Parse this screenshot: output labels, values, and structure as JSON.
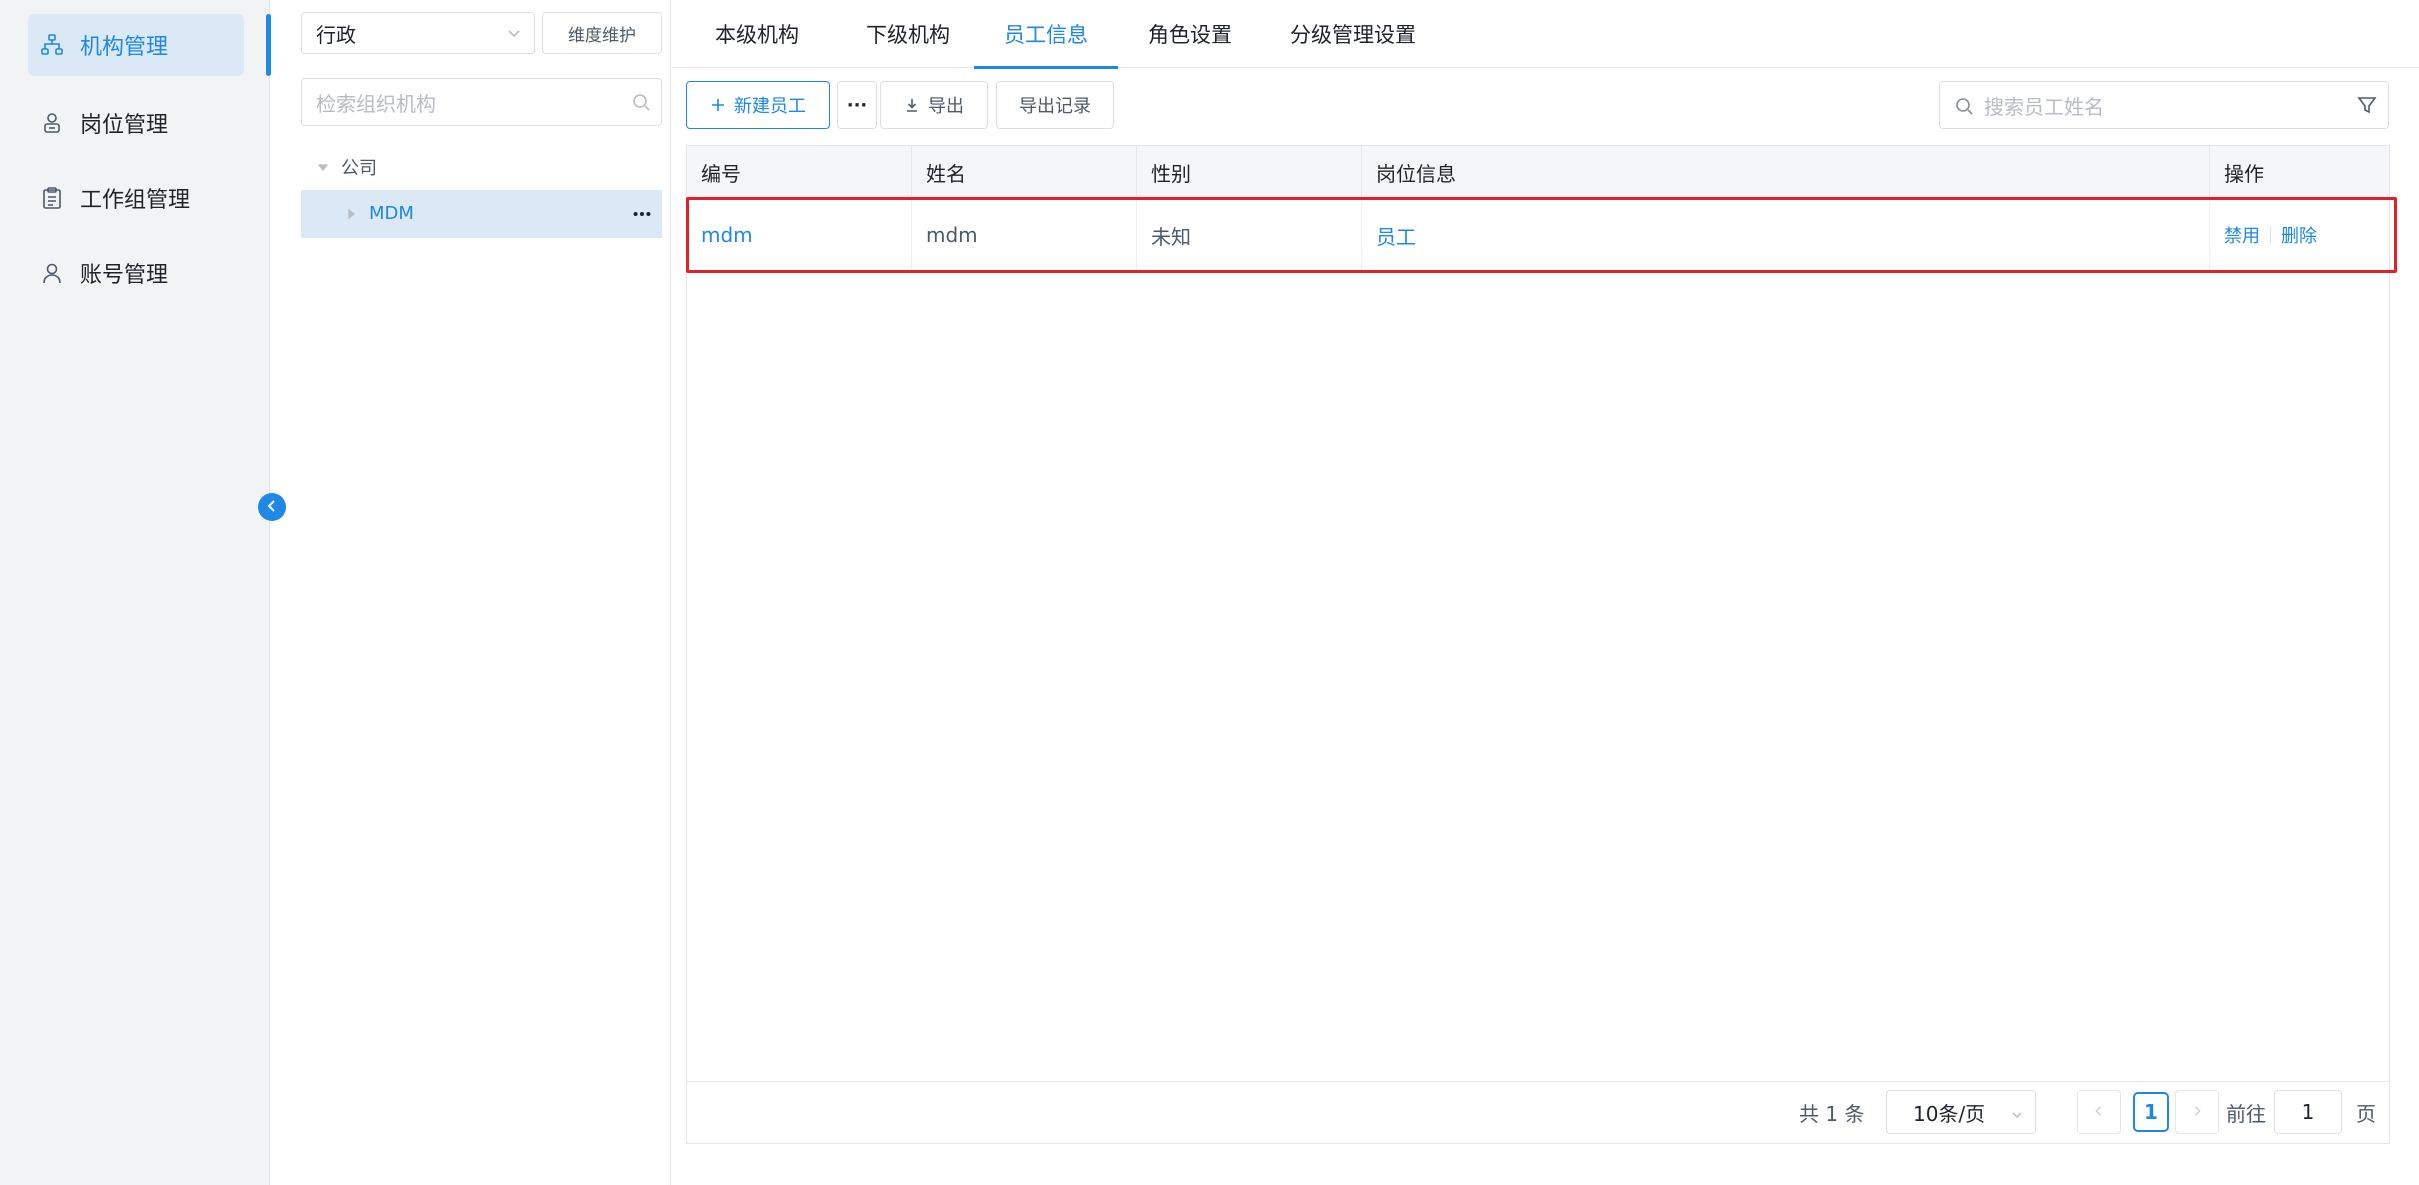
{
  "nav": {
    "items": [
      {
        "label": "机构管理",
        "icon": "org-tree-icon",
        "active": true
      },
      {
        "label": "岗位管理",
        "icon": "user-badge-icon",
        "active": false
      },
      {
        "label": "工作组管理",
        "icon": "clipboard-icon",
        "active": false
      },
      {
        "label": "账号管理",
        "icon": "user-icon",
        "active": false
      }
    ]
  },
  "tree": {
    "dimension_value": "行政",
    "dimension_button": "维度维护",
    "search_placeholder": "检索组织机构",
    "root_label": "公司",
    "child_label": "MDM"
  },
  "tabs": [
    "本级机构",
    "下级机构",
    "员工信息",
    "角色设置",
    "分级管理设置"
  ],
  "active_tab": "员工信息",
  "toolbar": {
    "new_label": "新建员工",
    "more_label": "···",
    "export_label": "导出",
    "export_log_label": "导出记录",
    "search_placeholder": "搜索员工姓名"
  },
  "table": {
    "headers": [
      "编号",
      "姓名",
      "性别",
      "岗位信息",
      "操作"
    ],
    "rows": [
      {
        "code": "mdm",
        "name": "mdm",
        "gender": "未知",
        "position": "员工",
        "ops": [
          "禁用",
          "删除"
        ]
      }
    ]
  },
  "pager": {
    "total": "共 1 条",
    "page_size": "10条/页",
    "current": "1",
    "goto_label": "前往",
    "goto_value": "1",
    "page_suffix": "页"
  },
  "colors": {
    "accent": "#1e88e5",
    "highlight": "#e0202a",
    "selected_bg": "#dbe9f7"
  }
}
